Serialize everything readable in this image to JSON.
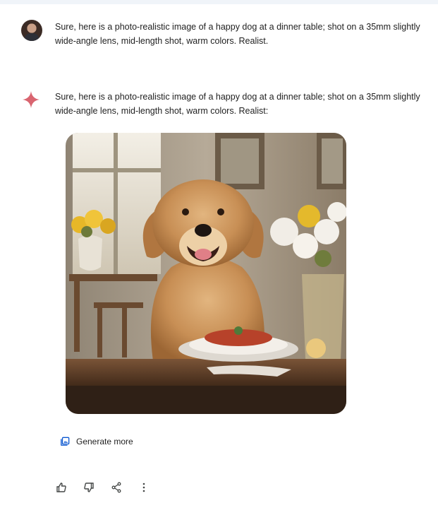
{
  "user_message": {
    "avatar": "user-avatar",
    "text": "Sure, here is a photo-realistic image of a happy dog at a dinner table; shot on a 35mm slightly wide-angle lens, mid-length shot, warm colors. Realist."
  },
  "model_response": {
    "icon": "gemini-sparkle-icon",
    "text": "Sure, here is a photo-realistic image of a happy dog at a dinner table; shot on a 35mm slightly wide-angle lens, mid-length shot, warm colors. Realist:",
    "image_alt": "golden retriever at a dinner table"
  },
  "generate_more": {
    "icon": "image-stack-icon",
    "label": "Generate more"
  },
  "actions": [
    {
      "name": "thumbs-up-icon"
    },
    {
      "name": "thumbs-down-icon"
    },
    {
      "name": "share-icon"
    },
    {
      "name": "more-vert-icon"
    }
  ],
  "colors": {
    "page_bg": "#f0f4f9",
    "card_bg": "#ffffff",
    "sparkle": "#d96570",
    "text": "#1f1f1f",
    "link_blue": "#0b57d0"
  }
}
